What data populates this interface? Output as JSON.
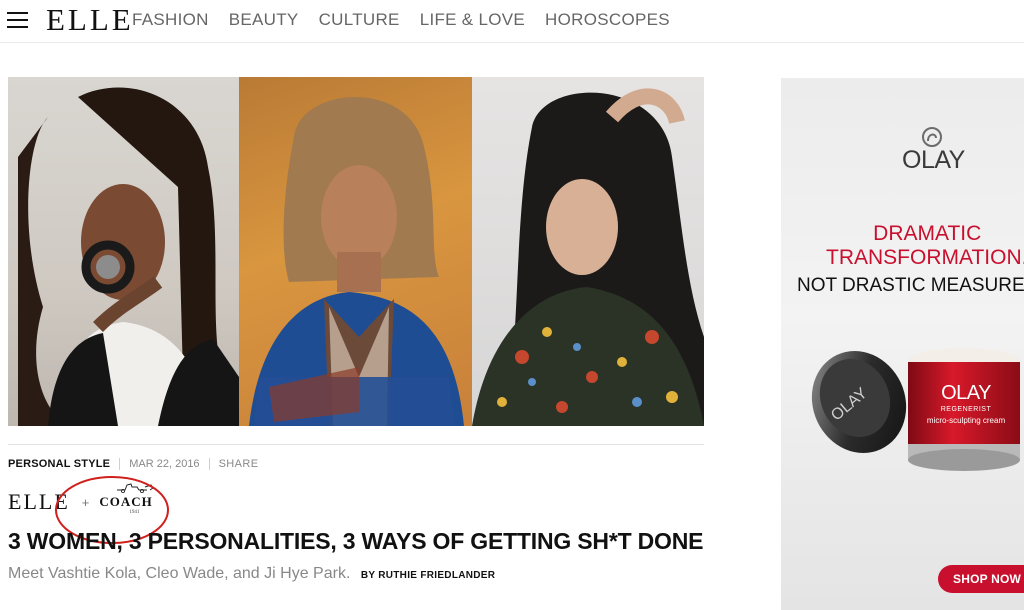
{
  "nav": {
    "logo": "ELLE",
    "links": [
      "FASHION",
      "BEAUTY",
      "CULTURE",
      "LIFE & LOVE",
      "HOROSCOPES"
    ]
  },
  "article": {
    "category": "PERSONAL STYLE",
    "date": "MAR 22, 2016",
    "share": "SHARE",
    "sponsor": {
      "partner_a": "ELLE",
      "plus": "+",
      "partner_b": "COACH",
      "partner_b_year": "1941"
    },
    "headline": "3 WOMEN, 3 PERSONALITIES, 3 WAYS OF GETTING SH*T DONE",
    "dek": "Meet Vashtie Kola, Cleo Wade, and Ji Hye Park.",
    "byline": "BY RUTHIE FRIEDLANDER"
  },
  "ad": {
    "brand": "OLAY",
    "headline_line1": "DRAMATIC",
    "headline_line2": "TRANSFORMATION.",
    "subheadline": "NOT DRASTIC MEASURES",
    "jar_brand": "OLAY",
    "jar_line": "REGENERIST",
    "jar_product": "micro-sculpting cream",
    "cta": "SHOP NOW"
  },
  "colors": {
    "ad_red": "#c8102e",
    "nav_text": "#666666",
    "annotation_red": "#d0201c"
  }
}
